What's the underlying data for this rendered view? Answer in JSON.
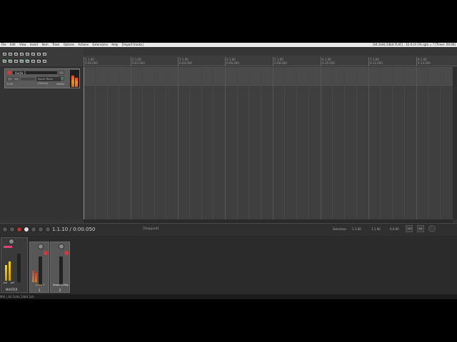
{
  "menubar": {
    "items": [
      "File",
      "Edit",
      "View",
      "Insert",
      "Item",
      "Track",
      "Options",
      "Actions",
      "Extensions",
      "Help",
      "[Import tracks]"
    ],
    "window_title": "[44.1kHz 24bit FLAC] : 32.0 ch 1% rgta = ? [Timer: 00:00]"
  },
  "track": {
    "name": "Audio 1",
    "input": "Input: Mono (Stereo)",
    "volume": "0.00",
    "pan": "center"
  },
  "ruler": {
    "labels": [
      {
        "top": "1.1.00",
        "bottom": "0:00.000"
      },
      {
        "top": "2.1.00",
        "bottom": "0:02.000"
      },
      {
        "top": "3.1.00",
        "bottom": "0:04.000"
      },
      {
        "top": "4.1.00",
        "bottom": "0:06.000"
      },
      {
        "top": "5.1.00",
        "bottom": "0:08.000"
      },
      {
        "top": "6.1.00",
        "bottom": "0:10.000"
      },
      {
        "top": "7.1.00",
        "bottom": "0:12.000"
      },
      {
        "top": "8.1.00",
        "bottom": "0:14.000"
      }
    ]
  },
  "transport": {
    "position": "1.1.10 / 0:00.050",
    "status": "[Stopped]",
    "selection_label": "Selection:",
    "sel_start": "1.1.00",
    "sel_end": "1.1.00",
    "sel_len": "0.0.00",
    "bpm": "120",
    "timesig": "4/4"
  },
  "mixer": {
    "master_label": "MASTER",
    "master_db_left": "-inf",
    "master_db_right": "-inf",
    "strip1_name": "Audio 1",
    "strip1_num": "1",
    "strip2_name": "ReaperW/Sep",
    "strip2_num": "2"
  },
  "statusbar": {
    "text": "MIX  |  44.1kHz 24bit 2ch"
  }
}
